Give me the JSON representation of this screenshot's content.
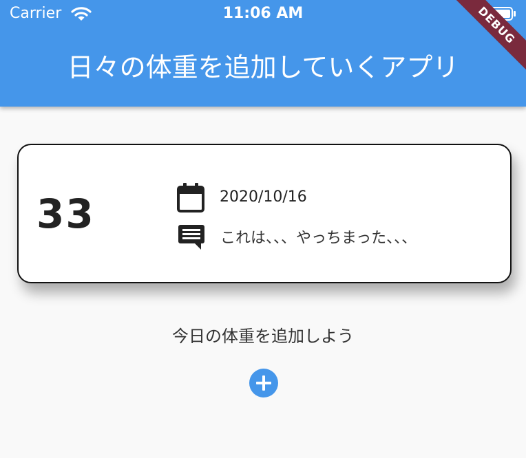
{
  "status_bar": {
    "carrier": "Carrier",
    "time": "11:06 AM"
  },
  "debug_banner": "DEBUG",
  "app_bar": {
    "title": "日々の体重を追加していくアプリ"
  },
  "entry_card": {
    "weight": "33",
    "date": "2020/10/16",
    "comment": "これは、、、やっちまった、、、",
    "icons": {
      "date": "calendar-icon",
      "comment": "comment-icon"
    }
  },
  "prompt": {
    "text": "今日の体重を追加しよう"
  },
  "add_button": {
    "icon": "add-circle-icon"
  },
  "colors": {
    "primary": "#4596ea",
    "background": "#f9f9f9",
    "debug_banner": "#7a2a3d",
    "card_border": "#111111"
  }
}
